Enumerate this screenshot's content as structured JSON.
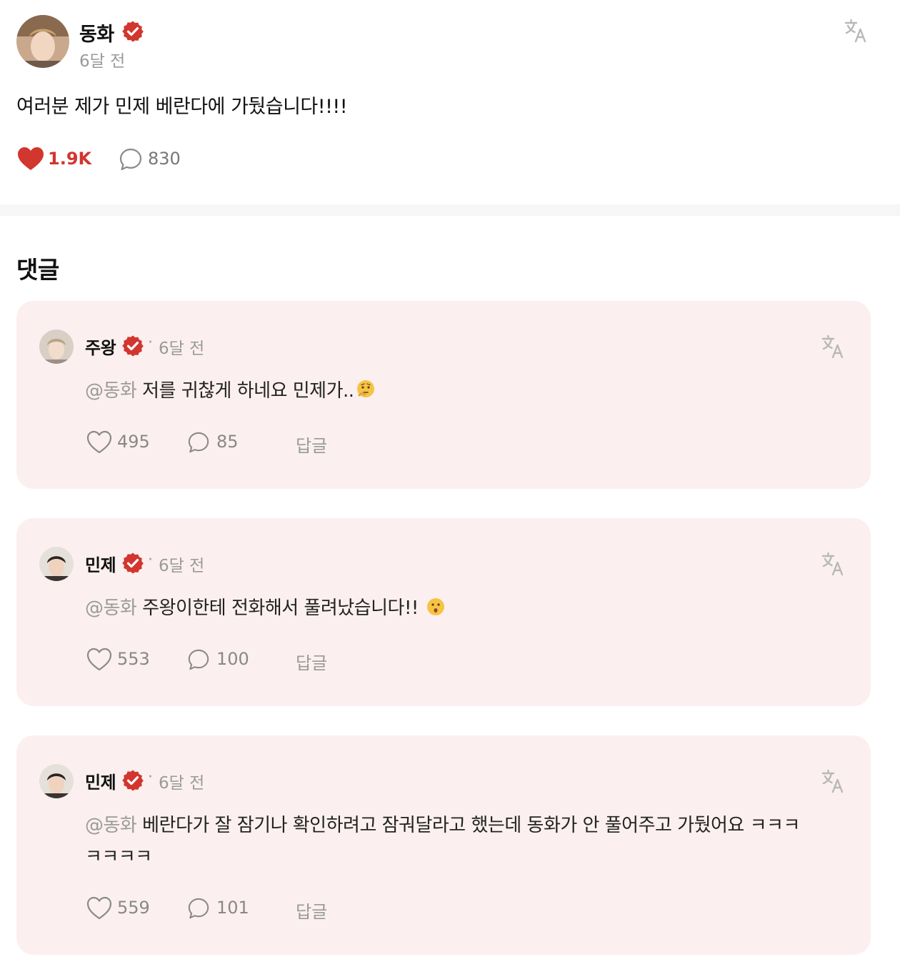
{
  "post": {
    "author": "동화",
    "time": "6달 전",
    "text": "여러분 제가 민제 베란다에 가뒀습니다!!!!",
    "likes": "1.9K",
    "comments": "830"
  },
  "comments_section": {
    "title": "댓글"
  },
  "comments": [
    {
      "author": "주왕",
      "dot": "·",
      "time": "6달 전",
      "mention": "@동화",
      "text": "저를 귀찮게 하네요 민제가..",
      "emoji": "thinking-face-icon",
      "likes": "495",
      "replies": "85",
      "reply_label": "답글"
    },
    {
      "author": "민제",
      "dot": "·",
      "time": "6달 전",
      "mention": "@동화",
      "text": "주왕이한테 전화해서 풀려났습니다!!",
      "emoji": "hushed-face-icon",
      "likes": "553",
      "replies": "100",
      "reply_label": "답글"
    },
    {
      "author": "민제",
      "dot": "·",
      "time": "6달 전",
      "mention": "@동화",
      "text": "베란다가 잘 잠기나 확인하려고 잠궈달라고 했는데 동화가 안 풀어주고 가뒀어요 ㅋㅋㅋㅋㅋㅋㅋ",
      "emoji": "",
      "likes": "559",
      "replies": "101",
      "reply_label": "답글"
    }
  ],
  "colors": {
    "accent": "#d2362e",
    "card_background": "#fbf0ef",
    "muted_text": "#9a9a9a"
  },
  "icons": {
    "verified": "verified-badge-icon",
    "translate": "translate-icon",
    "like_filled": "heart-filled-icon",
    "like_outline": "heart-outline-icon",
    "comment": "comment-bubble-icon"
  }
}
